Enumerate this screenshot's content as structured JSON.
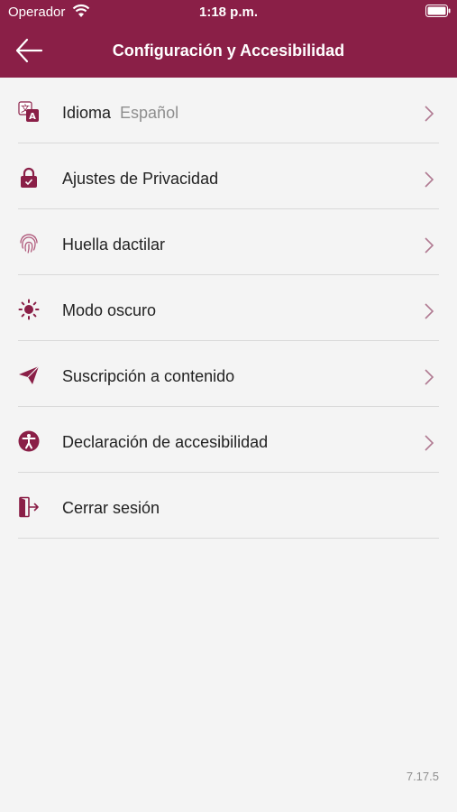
{
  "status_bar": {
    "carrier": "Operador",
    "time": "1:18 p.m."
  },
  "header": {
    "title": "Configuración y Accesibilidad"
  },
  "items": [
    {
      "label": "Idioma",
      "value": "Español",
      "icon": "translate-icon"
    },
    {
      "label": "Ajustes de Privacidad",
      "icon": "lock-icon"
    },
    {
      "label": "Huella dactilar",
      "icon": "fingerprint-icon"
    },
    {
      "label": "Modo oscuro",
      "icon": "sun-icon"
    },
    {
      "label": "Suscripción a contenido",
      "icon": "paper-plane-icon"
    },
    {
      "label": "Declaración de accesibilidad",
      "icon": "accessibility-icon"
    },
    {
      "label": "Cerrar sesión",
      "icon": "logout-icon"
    }
  ],
  "footer": {
    "version": "7.17.5"
  },
  "colors": {
    "brand": "#8a1f47",
    "background": "#f4f4f4",
    "chevron": "#b07a92"
  }
}
